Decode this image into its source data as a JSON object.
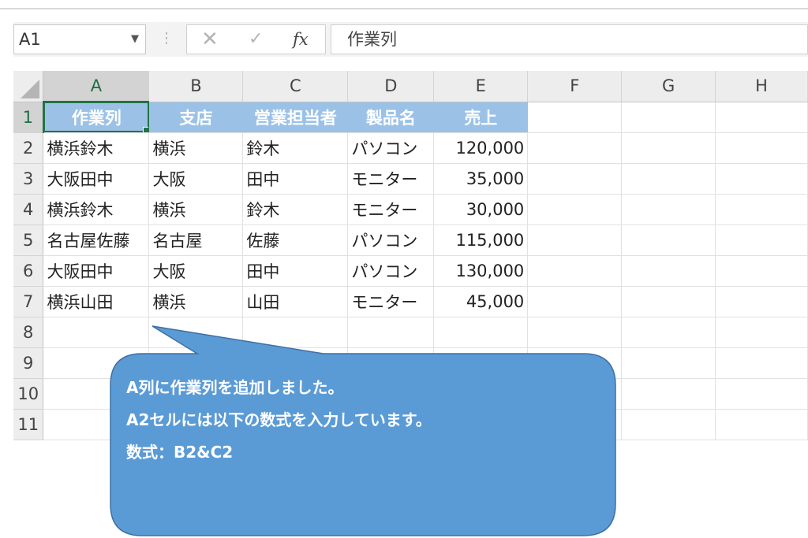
{
  "formula_bar": {
    "name_box": "A1",
    "cancel_icon": "✕",
    "enter_icon": "✓",
    "function_label": "fx",
    "formula": "作業列"
  },
  "columns": [
    "A",
    "B",
    "C",
    "D",
    "E",
    "F",
    "G",
    "H"
  ],
  "rows": [
    "1",
    "2",
    "3",
    "4",
    "5",
    "6",
    "7",
    "8",
    "9",
    "10",
    "11"
  ],
  "table": {
    "headers": [
      "作業列",
      "支店",
      "営業担当者",
      "製品名",
      "売上"
    ],
    "data": [
      [
        "横浜鈴木",
        "横浜",
        "鈴木",
        "パソコン",
        "120,000"
      ],
      [
        "大阪田中",
        "大阪",
        "田中",
        "モニター",
        "35,000"
      ],
      [
        "横浜鈴木",
        "横浜",
        "鈴木",
        "モニター",
        "30,000"
      ],
      [
        "名古屋佐藤",
        "名古屋",
        "佐藤",
        "パソコン",
        "115,000"
      ],
      [
        "大阪田中",
        "大阪",
        "田中",
        "パソコン",
        "130,000"
      ],
      [
        "横浜山田",
        "横浜",
        "山田",
        "モニター",
        "45,000"
      ]
    ]
  },
  "callout": {
    "line1": "A列に作業列を追加しました。",
    "line2": "A2セルには以下の数式を入力しています。",
    "line3": "数式：B2&C2"
  },
  "colors": {
    "header_fill": "#9bc2e6",
    "callout_fill": "#5b9bd5",
    "selection": "#217346"
  }
}
